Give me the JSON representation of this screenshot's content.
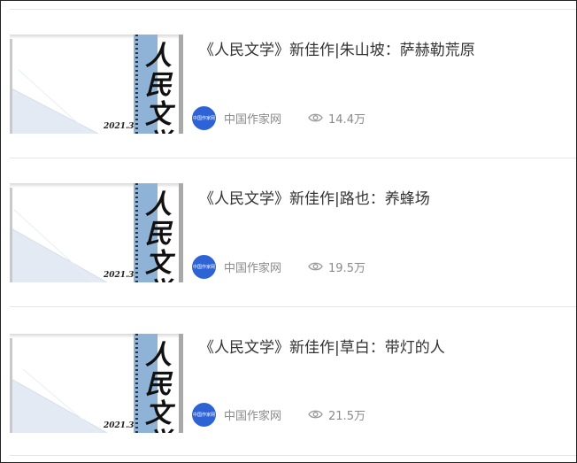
{
  "articles": [
    {
      "title": "《人民文学》新佳作|朱山坡：萨赫勒荒原",
      "source": "中国作家网",
      "views": "14.4万",
      "cover": {
        "calligraphy": "人民文学",
        "issue": "2021.3"
      },
      "avatar_text": "中国作家网"
    },
    {
      "title": "《人民文学》新佳作|路也：养蜂场",
      "source": "中国作家网",
      "views": "19.5万",
      "cover": {
        "calligraphy": "人民文学",
        "issue": "2021.3"
      },
      "avatar_text": "中国作家网"
    },
    {
      "title": "《人民文学》新佳作|草白：带灯的人",
      "source": "中国作家网",
      "views": "21.5万",
      "cover": {
        "calligraphy": "人民文学",
        "issue": "2021.3"
      },
      "avatar_text": "中国作家网"
    }
  ],
  "icons": {
    "source_avatar": "source-avatar-icon",
    "views": "eye-icon"
  },
  "colors": {
    "spine": "#8fb3d6",
    "avatar": "#2e63d6",
    "meta_text": "#8a8a8a"
  }
}
